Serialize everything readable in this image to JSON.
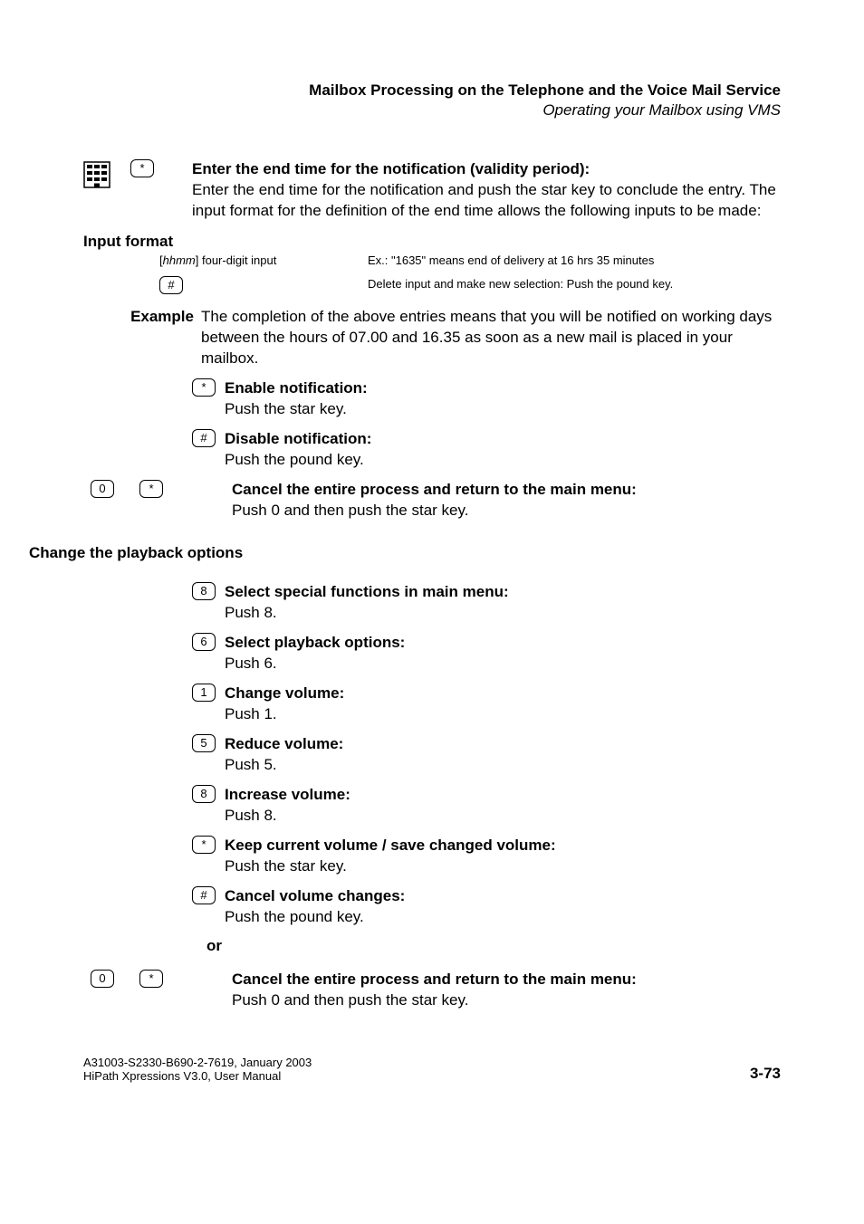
{
  "header": {
    "bold_line": "Mailbox Processing on the Telephone and the Voice Mail Service",
    "italic_line": "Operating your Mailbox using VMS"
  },
  "block_enter_end": {
    "title": "Enter the end time for the notification (validity period):",
    "body": "Enter the end time for the notification and push the star key to conclude the entry. The input format for the definition of the end time allows the following inputs to be made:"
  },
  "input_format": {
    "label": "Input format",
    "row1_left_prefix": "[",
    "row1_left_var": "hhmm",
    "row1_left_suffix": "] four-digit input",
    "row1_right": "Ex.: \"1635\" means end of delivery at 16 hrs 35 minutes",
    "row2_right": "Delete input and make new selection: Push the pound key."
  },
  "example": {
    "label": "Example",
    "text": "The completion of the above entries means that you will be notified on working days between the hours of 07.00 and 16.35 as soon as a new mail is placed in your mailbox."
  },
  "enable_notification": {
    "title": "Enable notification:",
    "body": "Push the star key."
  },
  "disable_notification": {
    "title": "Disable notification:",
    "body": "Push the pound key."
  },
  "cancel_main_1": {
    "title": "Cancel the entire process and return to the main menu:",
    "body": "Push 0 and then push the star key."
  },
  "playback_heading": "Change the playback options",
  "steps": {
    "select_special": {
      "title": "Select special functions in main menu:",
      "body": "Push 8."
    },
    "select_playback": {
      "title": "Select playback options:",
      "body": "Push 6."
    },
    "change_volume": {
      "title": "Change volume:",
      "body": "Push 1."
    },
    "reduce_volume": {
      "title": "Reduce volume:",
      "body": "Push 5."
    },
    "increase_volume": {
      "title": "Increase volume:",
      "body": "Push 8."
    },
    "keep_volume": {
      "title": "Keep current volume / save changed volume:",
      "body": "Push the star key."
    },
    "cancel_volume": {
      "title": "Cancel volume changes:",
      "body": "Push the pound key."
    }
  },
  "or_label": "or",
  "cancel_main_2": {
    "title": "Cancel the entire process and return to the main menu:",
    "body": "Push 0 and then push the star key."
  },
  "keys": {
    "star": "*",
    "hash": "#",
    "zero": "0",
    "one": "1",
    "five": "5",
    "six": "6",
    "eight": "8"
  },
  "footer": {
    "line1": "A31003-S2330-B690-2-7619, January 2003",
    "line2": "HiPath Xpressions V3.0, User Manual",
    "page": "3-73"
  }
}
